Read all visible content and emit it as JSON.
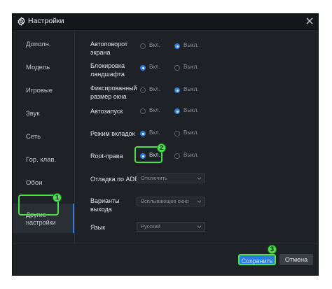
{
  "window": {
    "title": "Настройки"
  },
  "sidebar": {
    "items": [
      {
        "label": "Дополн."
      },
      {
        "label": "Модель"
      },
      {
        "label": "Игровые"
      },
      {
        "label": "Звук"
      },
      {
        "label": "Сеть"
      },
      {
        "label": "Гор. клав."
      },
      {
        "label": "Обои"
      },
      {
        "label_line1": "Другие",
        "label_line2": "настройки",
        "active": true
      }
    ]
  },
  "settings": {
    "autorotate": {
      "line1": "Автоповорот",
      "line2": "экрана",
      "on": "Вкл.",
      "off": "Выкл.",
      "selected": "off"
    },
    "landscape_lock": {
      "line1": "Блокировка",
      "line2": "ландшафта",
      "on": "Вкл.",
      "off": "Выкл.",
      "selected": "on"
    },
    "fixed_size": {
      "line1": "Фиксированный",
      "line2": "размер окна",
      "on": "Вкл.",
      "off": "Выкл.",
      "selected": "off"
    },
    "autostart": {
      "label": "Автозапуск",
      "on": "Вкл.",
      "off": "Выкл.",
      "selected": "off"
    },
    "tab_mode": {
      "label": "Режим вкладок",
      "on": "Вкл.",
      "off": "Выкл.",
      "selected": "on"
    },
    "root": {
      "label": "Root-права",
      "on": "Вкл.",
      "off": "Выкл.",
      "selected": "on"
    },
    "adb_debug": {
      "label": "Отладка по ADB",
      "value": "Отключить"
    },
    "exit_options": {
      "line1": "Варианты",
      "line2": "выхода",
      "value": "Всплывающее окно"
    },
    "language": {
      "label": "Язык",
      "value": "Русский"
    }
  },
  "footer": {
    "save": "Сохранить",
    "cancel": "Отмена"
  },
  "badges": {
    "b1": "1",
    "b2": "2",
    "b3": "3"
  },
  "colors": {
    "accent": "#2a7de1",
    "highlight": "#4fe04f",
    "background": "#1e2126"
  }
}
